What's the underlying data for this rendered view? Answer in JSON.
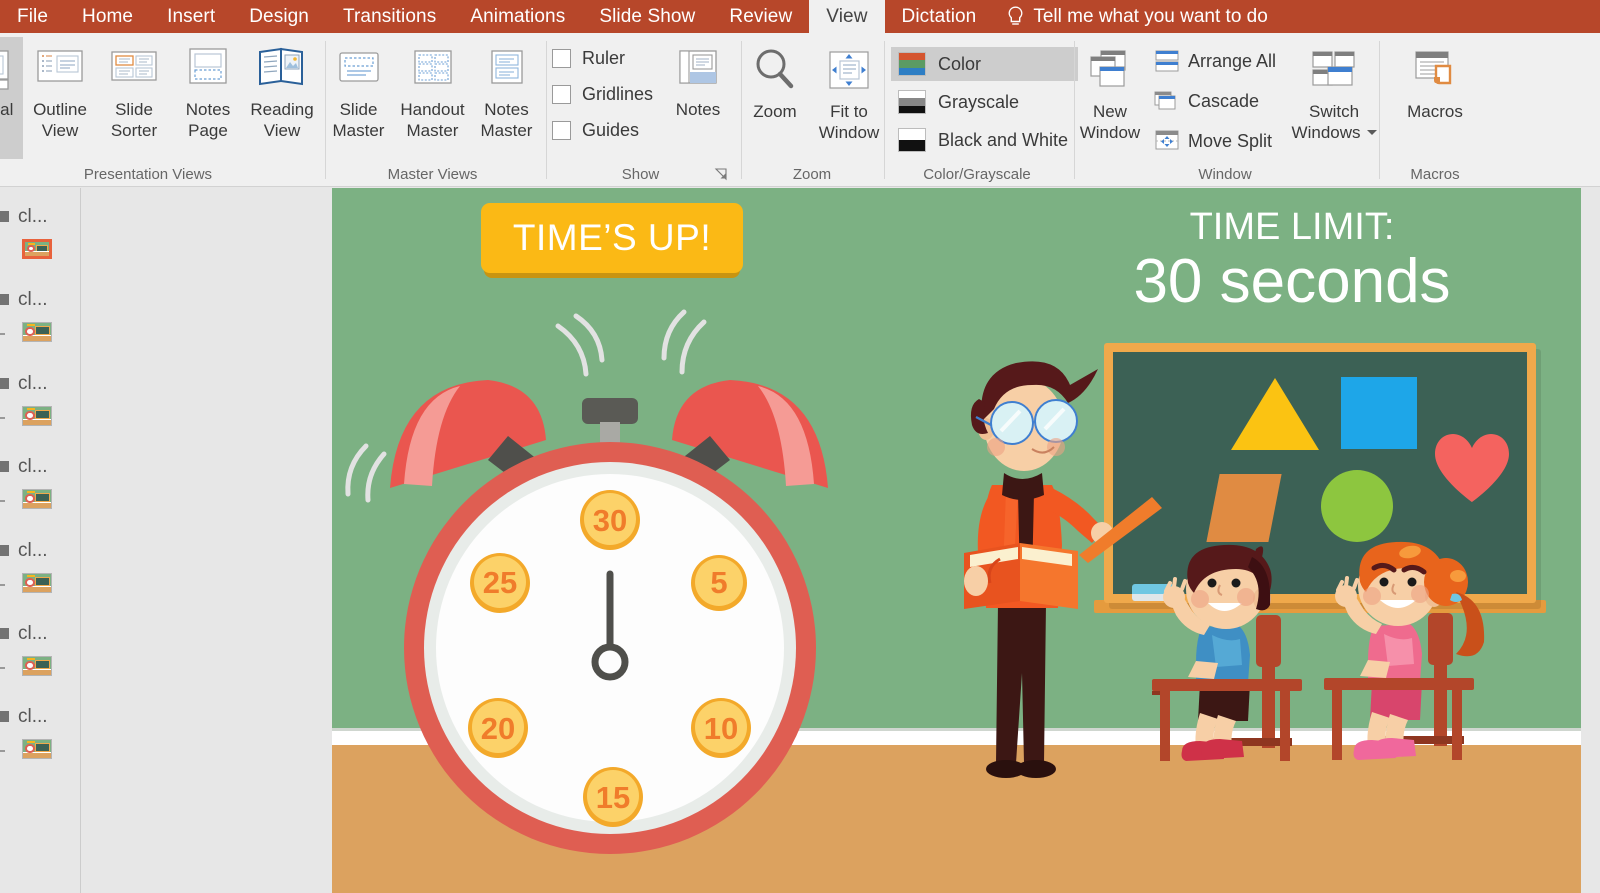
{
  "ribbon": {
    "tabs": [
      {
        "label": "File",
        "active": false
      },
      {
        "label": "Home",
        "active": false
      },
      {
        "label": "Insert",
        "active": false
      },
      {
        "label": "Design",
        "active": false
      },
      {
        "label": "Transitions",
        "active": false
      },
      {
        "label": "Animations",
        "active": false
      },
      {
        "label": "Slide Show",
        "active": false
      },
      {
        "label": "Review",
        "active": false
      },
      {
        "label": "View",
        "active": true
      },
      {
        "label": "Dictation",
        "active": false
      }
    ],
    "tell_me": "Tell me what you want to do",
    "accent_color": "#b7472a",
    "groups": {
      "presentation_views": {
        "title": "Presentation Views",
        "items": [
          {
            "label": "Normal",
            "selected": true
          },
          {
            "label": "Outline\nView",
            "line1": "Outline",
            "line2": "View",
            "selected": false
          },
          {
            "label": "Slide\nSorter",
            "line1": "Slide",
            "line2": "Sorter",
            "selected": false
          },
          {
            "label": "Notes\nPage",
            "line1": "Notes",
            "line2": "Page",
            "selected": false
          },
          {
            "label": "Reading\nView",
            "line1": "Reading",
            "line2": "View",
            "selected": false
          }
        ]
      },
      "master_views": {
        "title": "Master Views",
        "items": [
          {
            "line1": "Slide",
            "line2": "Master"
          },
          {
            "line1": "Handout",
            "line2": "Master"
          },
          {
            "line1": "Notes",
            "line2": "Master"
          }
        ]
      },
      "show": {
        "title": "Show",
        "checkboxes": [
          {
            "label": "Ruler",
            "checked": false
          },
          {
            "label": "Gridlines",
            "checked": false
          },
          {
            "label": "Guides",
            "checked": false
          }
        ],
        "notes_label": "Notes"
      },
      "zoom": {
        "title": "Zoom",
        "zoom_label": "Zoom",
        "fit_line1": "Fit to",
        "fit_line2": "Window"
      },
      "color_grayscale": {
        "title": "Color/Grayscale",
        "options": [
          {
            "label": "Color",
            "selected": true
          },
          {
            "label": "Grayscale",
            "selected": false
          },
          {
            "label": "Black and White",
            "selected": false
          }
        ]
      },
      "window": {
        "title": "Window",
        "new_window_line1": "New",
        "new_window_line2": "Window",
        "arrange_all": "Arrange All",
        "cascade": "Cascade",
        "move_split": "Move Split",
        "switch_line1": "Switch",
        "switch_line2": "Windows"
      },
      "macros": {
        "title": "Macros",
        "macros_label": "Macros"
      }
    }
  },
  "thumbnail_panel": {
    "items": [
      {
        "label": "cl...",
        "selected": true
      },
      {
        "label": "cl...",
        "selected": false
      },
      {
        "label": "cl...",
        "selected": false
      },
      {
        "label": "cl...",
        "selected": false
      },
      {
        "label": "cl...",
        "selected": false
      },
      {
        "label": "cl...",
        "selected": false
      },
      {
        "label": "cl...",
        "selected": false
      }
    ]
  },
  "slide": {
    "banner_text": "TIME’S UP!",
    "title_line1": "TIME LIMIT:",
    "title_line2": "30 seconds",
    "clock": {
      "markers": [
        "30",
        "5",
        "10",
        "15",
        "20",
        "25"
      ],
      "hand_points_to": "30"
    },
    "chalkboard": {
      "shapes": [
        "triangle",
        "square",
        "heart",
        "parallelogram",
        "circle"
      ]
    },
    "colors": {
      "wall": "#7cb183",
      "floor": "#dca25f",
      "banner": "#fbb915",
      "banner_shadow": "#c89411",
      "clock_body": "#e05a4e",
      "clock_face": "#fdfdfd",
      "marker": "#fcd269",
      "marker_ring": "#f3a92a",
      "marker_text": "#f07c2b",
      "board_frame": "#f0a94b",
      "board": "#3c6155",
      "triangle": "#fbc312",
      "square": "#1ea6e8",
      "heart": "#f4635f",
      "parallelogram": "#e08b42",
      "circle": "#8dc63f",
      "teacher_sweater": "#f25822",
      "teacher_pants": "#3c1714",
      "boy_shirt": "#3f8fc4",
      "girl_shirt": "#ef6b8e",
      "desk": "#b3462a"
    }
  }
}
